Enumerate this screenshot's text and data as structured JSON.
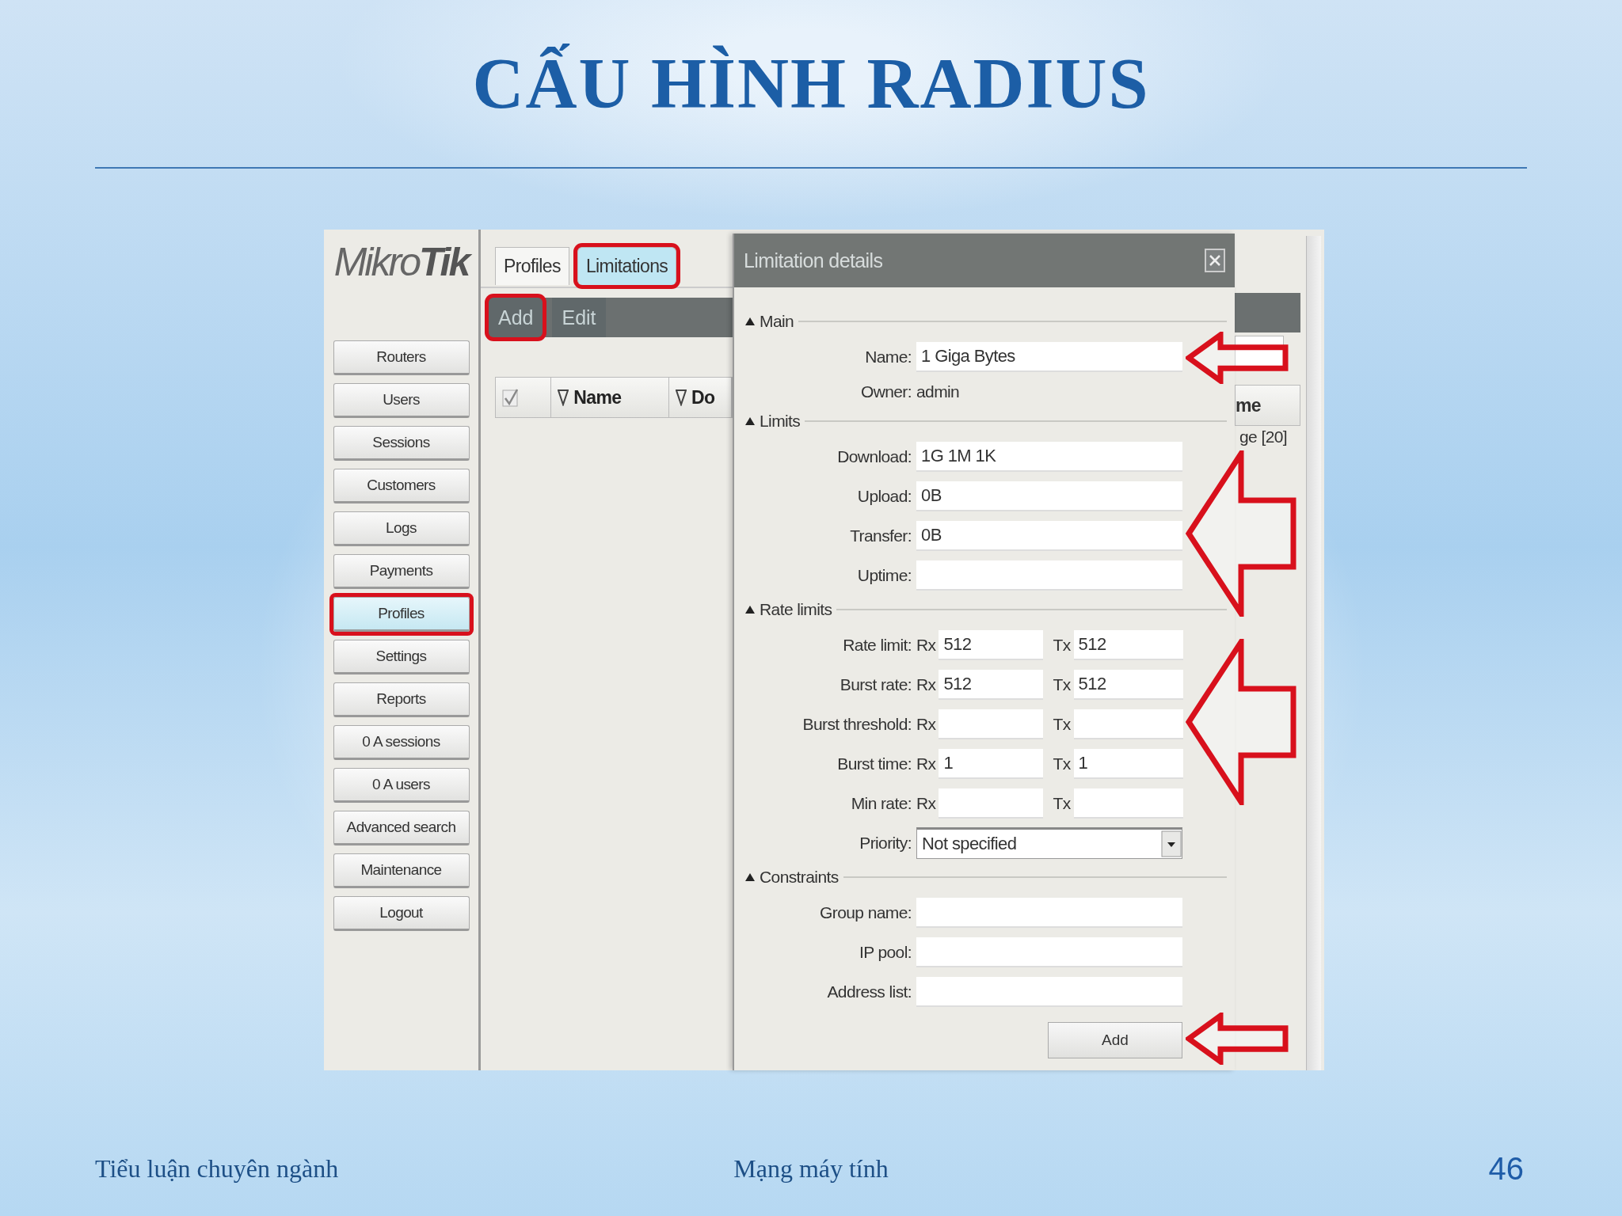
{
  "slide": {
    "title": "CẤU HÌNH RADIUS",
    "footer_left": "Tiểu luận chuyên ngành",
    "footer_center": "Mạng máy tính",
    "page_number": "46"
  },
  "app": {
    "logo": {
      "light": "Mikro",
      "bold": "Tik"
    },
    "sidebar": [
      {
        "label": "Routers",
        "selected": false,
        "highlighted": false
      },
      {
        "label": "Users",
        "selected": false,
        "highlighted": false
      },
      {
        "label": "Sessions",
        "selected": false,
        "highlighted": false
      },
      {
        "label": "Customers",
        "selected": false,
        "highlighted": false
      },
      {
        "label": "Logs",
        "selected": false,
        "highlighted": false
      },
      {
        "label": "Payments",
        "selected": false,
        "highlighted": false
      },
      {
        "label": "Profiles",
        "selected": true,
        "highlighted": true
      },
      {
        "label": "Settings",
        "selected": false,
        "highlighted": false
      },
      {
        "label": "Reports",
        "selected": false,
        "highlighted": false
      },
      {
        "label": "0 A sessions",
        "selected": false,
        "highlighted": false
      },
      {
        "label": "0 A users",
        "selected": false,
        "highlighted": false
      },
      {
        "label": "Advanced search",
        "selected": false,
        "highlighted": false
      },
      {
        "label": "Maintenance",
        "selected": false,
        "highlighted": false
      },
      {
        "label": "Logout",
        "selected": false,
        "highlighted": false
      }
    ],
    "tabs": [
      {
        "label": "Profiles",
        "selected": false,
        "highlighted": false
      },
      {
        "label": "Limitations",
        "selected": true,
        "highlighted": true
      }
    ],
    "toolbar": [
      {
        "label": "Add",
        "highlighted": true
      },
      {
        "label": "Edit",
        "highlighted": false
      }
    ],
    "table": {
      "columns": [
        {
          "kind": "checkbox"
        },
        {
          "kind": "sort",
          "label": "Name"
        },
        {
          "kind": "sort",
          "label": "Do"
        }
      ],
      "right_column": "me",
      "right_cell": "ge [20]"
    },
    "dialog": {
      "title": "Limitation details",
      "sections": [
        {
          "title": "Main",
          "rows": [
            {
              "kind": "field",
              "label": "Name:",
              "value": "1 Giga Bytes",
              "arrow": true
            },
            {
              "kind": "text",
              "label": "Owner:",
              "value": "admin"
            }
          ]
        },
        {
          "title": "Limits",
          "arrow": true,
          "rows": [
            {
              "kind": "field",
              "label": "Download:",
              "value": "1G 1M 1K"
            },
            {
              "kind": "field",
              "label": "Upload:",
              "value": "0B"
            },
            {
              "kind": "field",
              "label": "Transfer:",
              "value": "0B"
            },
            {
              "kind": "field",
              "label": "Uptime:"
            }
          ]
        },
        {
          "title": "Rate limits",
          "arrow": true,
          "rows": [
            {
              "kind": "pair",
              "label": "Rate limit:",
              "rx": "Rx",
              "rx_value": "512",
              "tx": "Tx",
              "tx_value": "512"
            },
            {
              "kind": "pair",
              "label": "Burst rate:",
              "rx": "Rx",
              "rx_value": "512",
              "tx": "Tx",
              "tx_value": "512"
            },
            {
              "kind": "pair",
              "label": "Burst threshold:",
              "rx": "Rx",
              "tx": "Tx"
            },
            {
              "kind": "pair",
              "label": "Burst time:",
              "rx": "Rx",
              "rx_value": "1",
              "tx": "Tx",
              "tx_value": "1"
            },
            {
              "kind": "pair",
              "label": "Min rate:",
              "rx": "Rx",
              "tx": "Tx"
            },
            {
              "kind": "select",
              "label": "Priority:",
              "value": "Not specified"
            }
          ]
        },
        {
          "title": "Constraints",
          "rows": [
            {
              "kind": "field",
              "label": "Group name:"
            },
            {
              "kind": "field",
              "label": "IP pool:"
            },
            {
              "kind": "field",
              "label": "Address list:"
            }
          ]
        }
      ],
      "button": {
        "label": "Add",
        "arrow": true
      }
    }
  }
}
